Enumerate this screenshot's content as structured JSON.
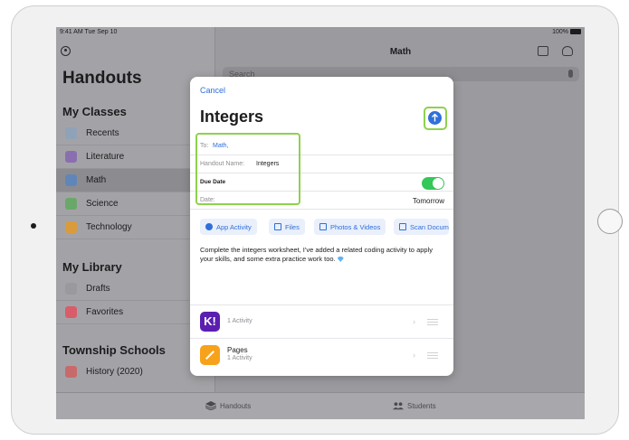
{
  "status_bar": {
    "time": "9:41 AM  Tue Sep 10",
    "battery": "100%"
  },
  "sidebar": {
    "title": "Handouts",
    "sections": [
      {
        "heading": "My Classes",
        "items": [
          {
            "label": "Recents",
            "color": "#8fa2b8"
          },
          {
            "label": "Literature",
            "color": "#8a6fb0"
          },
          {
            "label": "Math",
            "color": "#5f86b8",
            "selected": true
          },
          {
            "label": "Science",
            "color": "#6aa86a"
          },
          {
            "label": "Technology",
            "color": "#d99b3c"
          }
        ]
      },
      {
        "heading": "My Library",
        "items": [
          {
            "label": "Drafts",
            "color": "#9a9a9e"
          },
          {
            "label": "Favorites",
            "color": "#d95c6a"
          }
        ]
      },
      {
        "heading": "Township Schools",
        "items": [
          {
            "label": "History (2020)",
            "color": "#c86a6a"
          }
        ]
      }
    ]
  },
  "detail": {
    "title": "Math",
    "search_placeholder": "Search"
  },
  "tabbar": {
    "handouts": "Handouts",
    "students": "Students"
  },
  "modal": {
    "cancel": "Cancel",
    "title": "Integers",
    "to_label": "To:",
    "to_value": "Math,",
    "handout_name_label": "Handout Name:",
    "handout_name_value": "Integers",
    "due_date_label": "Due Date",
    "date_label": "Date:",
    "date_value": "Tomorrow",
    "chips": [
      "App Activity",
      "Files",
      "Photos & Videos",
      "Scan Docum"
    ],
    "body_text": "Complete the integers worksheet, I've added a related coding activity to apply your skills, and some extra practice work too.",
    "activities": [
      {
        "name": "",
        "sub": "1 Activity",
        "icon_letter": "K!"
      },
      {
        "name": "Pages",
        "sub": "1 Activity"
      }
    ]
  }
}
